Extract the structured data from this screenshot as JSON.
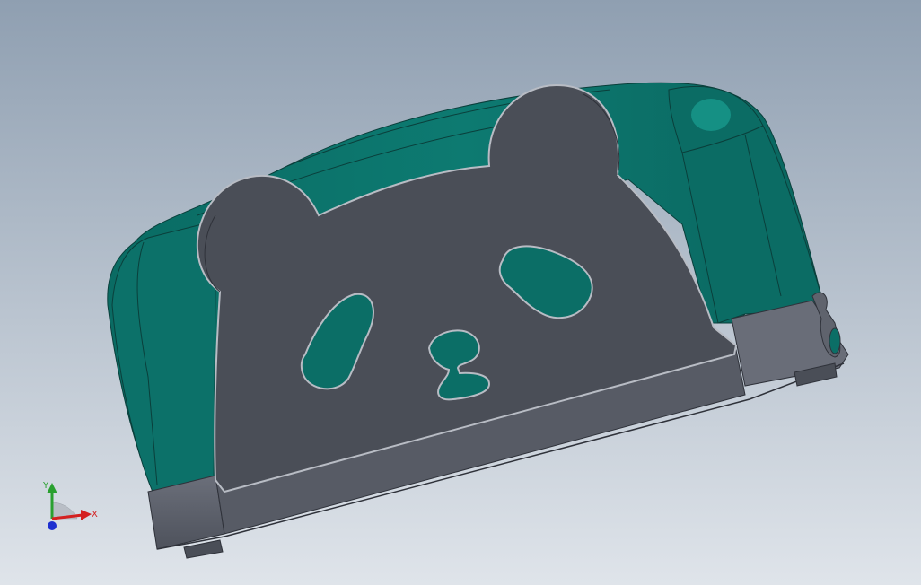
{
  "viewport": {
    "background_top": "#8f9fb1",
    "background_bottom": "#dfe4ea"
  },
  "model": {
    "shell_color": "#0b6e66",
    "shell_dark": "#064f49",
    "shell_light": "#1b8a80",
    "face_color": "#4b4f58",
    "face_edge": "#a8adb6",
    "base_color": "#5a5e68",
    "base_light": "#777b86"
  },
  "triad": {
    "x_label": "X",
    "y_label": "Y",
    "x_color": "#d42020",
    "y_color": "#2aa030",
    "z_color": "#1d2fd0"
  }
}
